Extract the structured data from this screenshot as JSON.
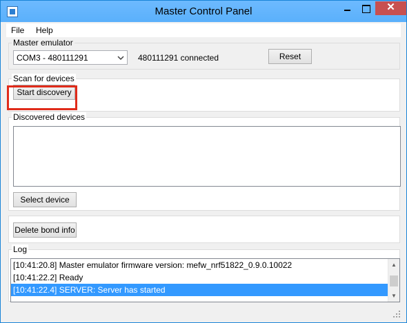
{
  "window": {
    "title": "Master Control Panel",
    "close_glyph": "✕"
  },
  "menu": {
    "file": "File",
    "help": "Help"
  },
  "master_emulator": {
    "legend": "Master emulator",
    "selected_port": "COM3 - 480111291",
    "status": "480111291 connected",
    "reset_label": "Reset"
  },
  "scan": {
    "legend": "Scan for devices",
    "start_label": "Start discovery"
  },
  "discovered": {
    "legend": "Discovered devices",
    "items": [],
    "select_label": "Select device"
  },
  "bond": {
    "delete_label": "Delete bond info"
  },
  "log": {
    "legend": "Log",
    "lines": [
      "[10:41:20.8] Master emulator firmware version: mefw_nrf51822_0.9.0.10022",
      "[10:41:22.2] Ready",
      "[10:41:22.4] SERVER: Server has started"
    ],
    "selected_index": 2
  },
  "colors": {
    "titlebar": "#5db2ff",
    "close_button": "#c75050",
    "selection": "#3399ff",
    "highlight_box": "#e02b1a"
  }
}
